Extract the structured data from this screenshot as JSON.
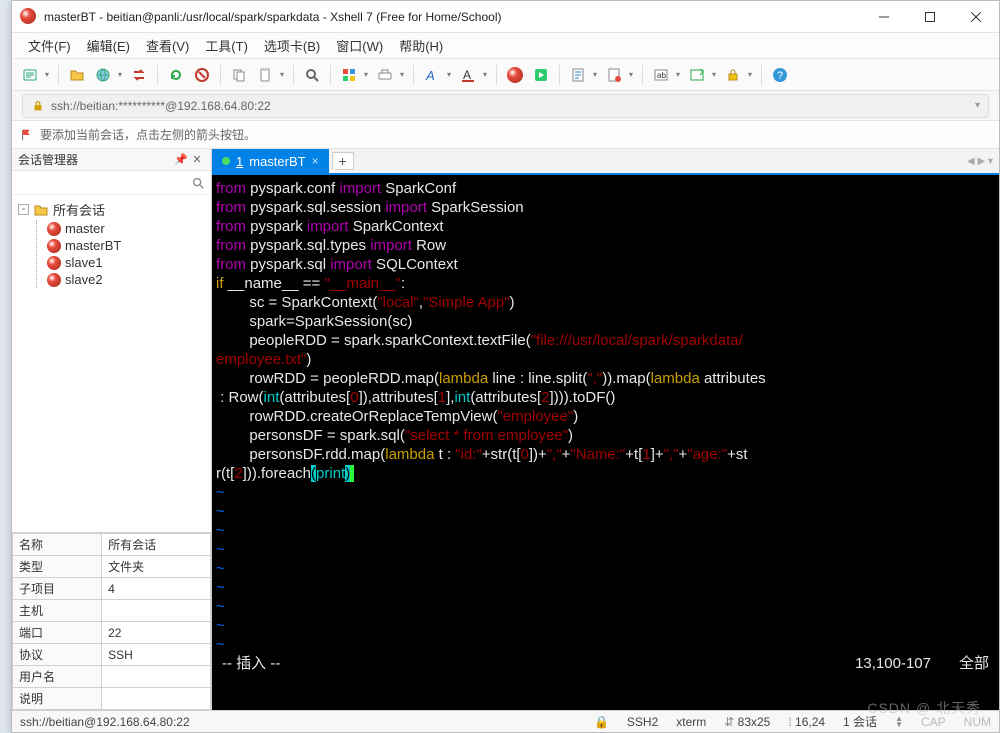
{
  "title": "masterBT - beitian@panli:/usr/local/spark/sparkdata - Xshell 7 (Free for Home/School)",
  "menus": [
    "文件(F)",
    "编辑(E)",
    "查看(V)",
    "工具(T)",
    "选项卡(B)",
    "窗口(W)",
    "帮助(H)"
  ],
  "address": "ssh://beitian:**********@192.168.64.80:22",
  "info_strip": "要添加当前会话，点击左侧的箭头按钮。",
  "sessmgr": {
    "title": "会话管理器",
    "root": "所有会话",
    "items": [
      "master",
      "masterBT",
      "slave1",
      "slave2"
    ]
  },
  "props": {
    "rows": [
      [
        "名称",
        "所有会话"
      ],
      [
        "类型",
        "文件夹"
      ],
      [
        "子项目",
        "4"
      ],
      [
        "主机",
        ""
      ],
      [
        "端口",
        "22"
      ],
      [
        "协议",
        "SSH"
      ],
      [
        "用户名",
        ""
      ],
      [
        "说明",
        ""
      ]
    ]
  },
  "tab": {
    "index": "1",
    "label": "masterBT"
  },
  "code": {
    "l1": {
      "a": "from",
      "b": " pyspark.conf ",
      "c": "import",
      "d": " SparkConf"
    },
    "l2": {
      "a": "from",
      "b": " pyspark.sql.session ",
      "c": "import",
      "d": " SparkSession"
    },
    "l3": {
      "a": "from",
      "b": " pyspark ",
      "c": "import",
      "d": " SparkContext"
    },
    "l4": {
      "a": "from",
      "b": " pyspark.sql.types ",
      "c": "import",
      "d": " Row"
    },
    "l5": {
      "a": "from",
      "b": " pyspark.sql ",
      "c": "import",
      "d": " SQLContext"
    },
    "l6": {
      "a": "if",
      "b": " __name__ ",
      "c": "==",
      "d": " ",
      "e": "\"__main__\"",
      "f": ":"
    },
    "l7": {
      "a": "        sc = SparkContext(",
      "b": "\"local\"",
      "c": ",",
      "d": "\"Simple App\"",
      "e": ")"
    },
    "l8": "        spark=SparkSession(sc)",
    "l9": {
      "a": "        peopleRDD = spark.sparkContext.textFile(",
      "b": "\"file:///usr/local/spark/sparkdata/",
      "c": "employee.txt\"",
      "d": ")"
    },
    "l10": {
      "a": "        rowRDD = peopleRDD.map(",
      "b": "lambda",
      "c": " line : line.split(",
      "d": "\",\"",
      "e": ")).map(",
      "f": "lambda",
      "g": " attributes",
      "h": " : Row(",
      "i": "int",
      "j": "(attributes[",
      "k": "0",
      "l": "]),attributes[",
      "m": "1",
      "n": "],",
      "o": "int",
      "p": "(attributes[",
      "q": "2",
      "r": "]))).toDF()"
    },
    "l11": {
      "a": "        rowRDD.createOrReplaceTempView(",
      "b": "\"employee\"",
      "c": ")"
    },
    "l12": {
      "a": "        personsDF = spark.sql(",
      "b": "\"select * from employee\"",
      "c": ")"
    },
    "l13": {
      "a": "        personsDF.rdd.map(",
      "b": "lambda",
      "c": " t : ",
      "d": "\"id:\"",
      "e": "+str(t[",
      "f": "0",
      "g": "])+",
      "h": "\",\"",
      "i": "+",
      "j": "\"Name:\"",
      "k": "+t[",
      "l": "1",
      "m": "]+",
      "n": "\",\"",
      "o": "+",
      "p": "\"age:\"",
      "q": "+st",
      "r": "r(t[",
      "s": "2",
      "t": "])).foreach",
      "u": "(",
      "v": "print",
      "w": ")"
    }
  },
  "vim": {
    "mode": "-- 插入 --",
    "pos": "13,100-107",
    "scroll": "全部"
  },
  "status": {
    "left": "ssh://beitian@192.168.64.80:22",
    "ssh": "SSH2",
    "term": "xterm",
    "size": "83x25",
    "cursor": "16,24",
    "sessions": "1 会话",
    "cap": "CAP",
    "num": "NUM"
  },
  "watermark": "CSDN @ 北天秀"
}
